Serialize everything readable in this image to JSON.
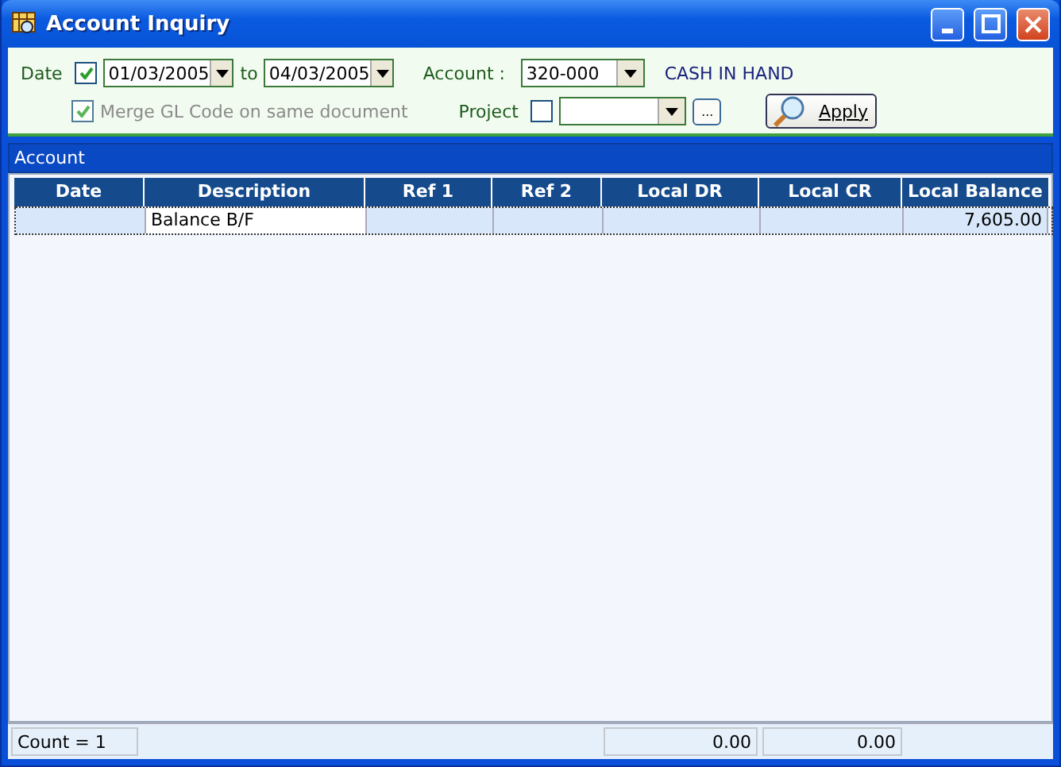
{
  "window": {
    "title": "Account Inquiry"
  },
  "filters": {
    "date_label": "Date",
    "date_enabled": true,
    "date_from": "01/03/2005",
    "to_label": "to",
    "date_to": "04/03/2005",
    "account_label": "Account :",
    "account": "320-000",
    "account_name": "CASH IN HAND",
    "merge": {
      "label": "Merge GL Code on same document",
      "checked": true,
      "disabled": true
    },
    "project_label": "Project",
    "project_enabled": false,
    "browse_button": "...",
    "apply_button": "Apply"
  },
  "band": {
    "title": "Account"
  },
  "table": {
    "columns": [
      "Date",
      "Description",
      "Ref 1",
      "Ref 2",
      "Local DR",
      "Local CR",
      "Local Balance"
    ],
    "rows": [
      {
        "cells": [
          "",
          "Balance B/F",
          "",
          "",
          "",
          "",
          "7,605.00"
        ],
        "selected": true
      }
    ]
  },
  "footer": {
    "count": "Count = 1",
    "total_dr": "0.00",
    "total_cr": "0.00"
  }
}
